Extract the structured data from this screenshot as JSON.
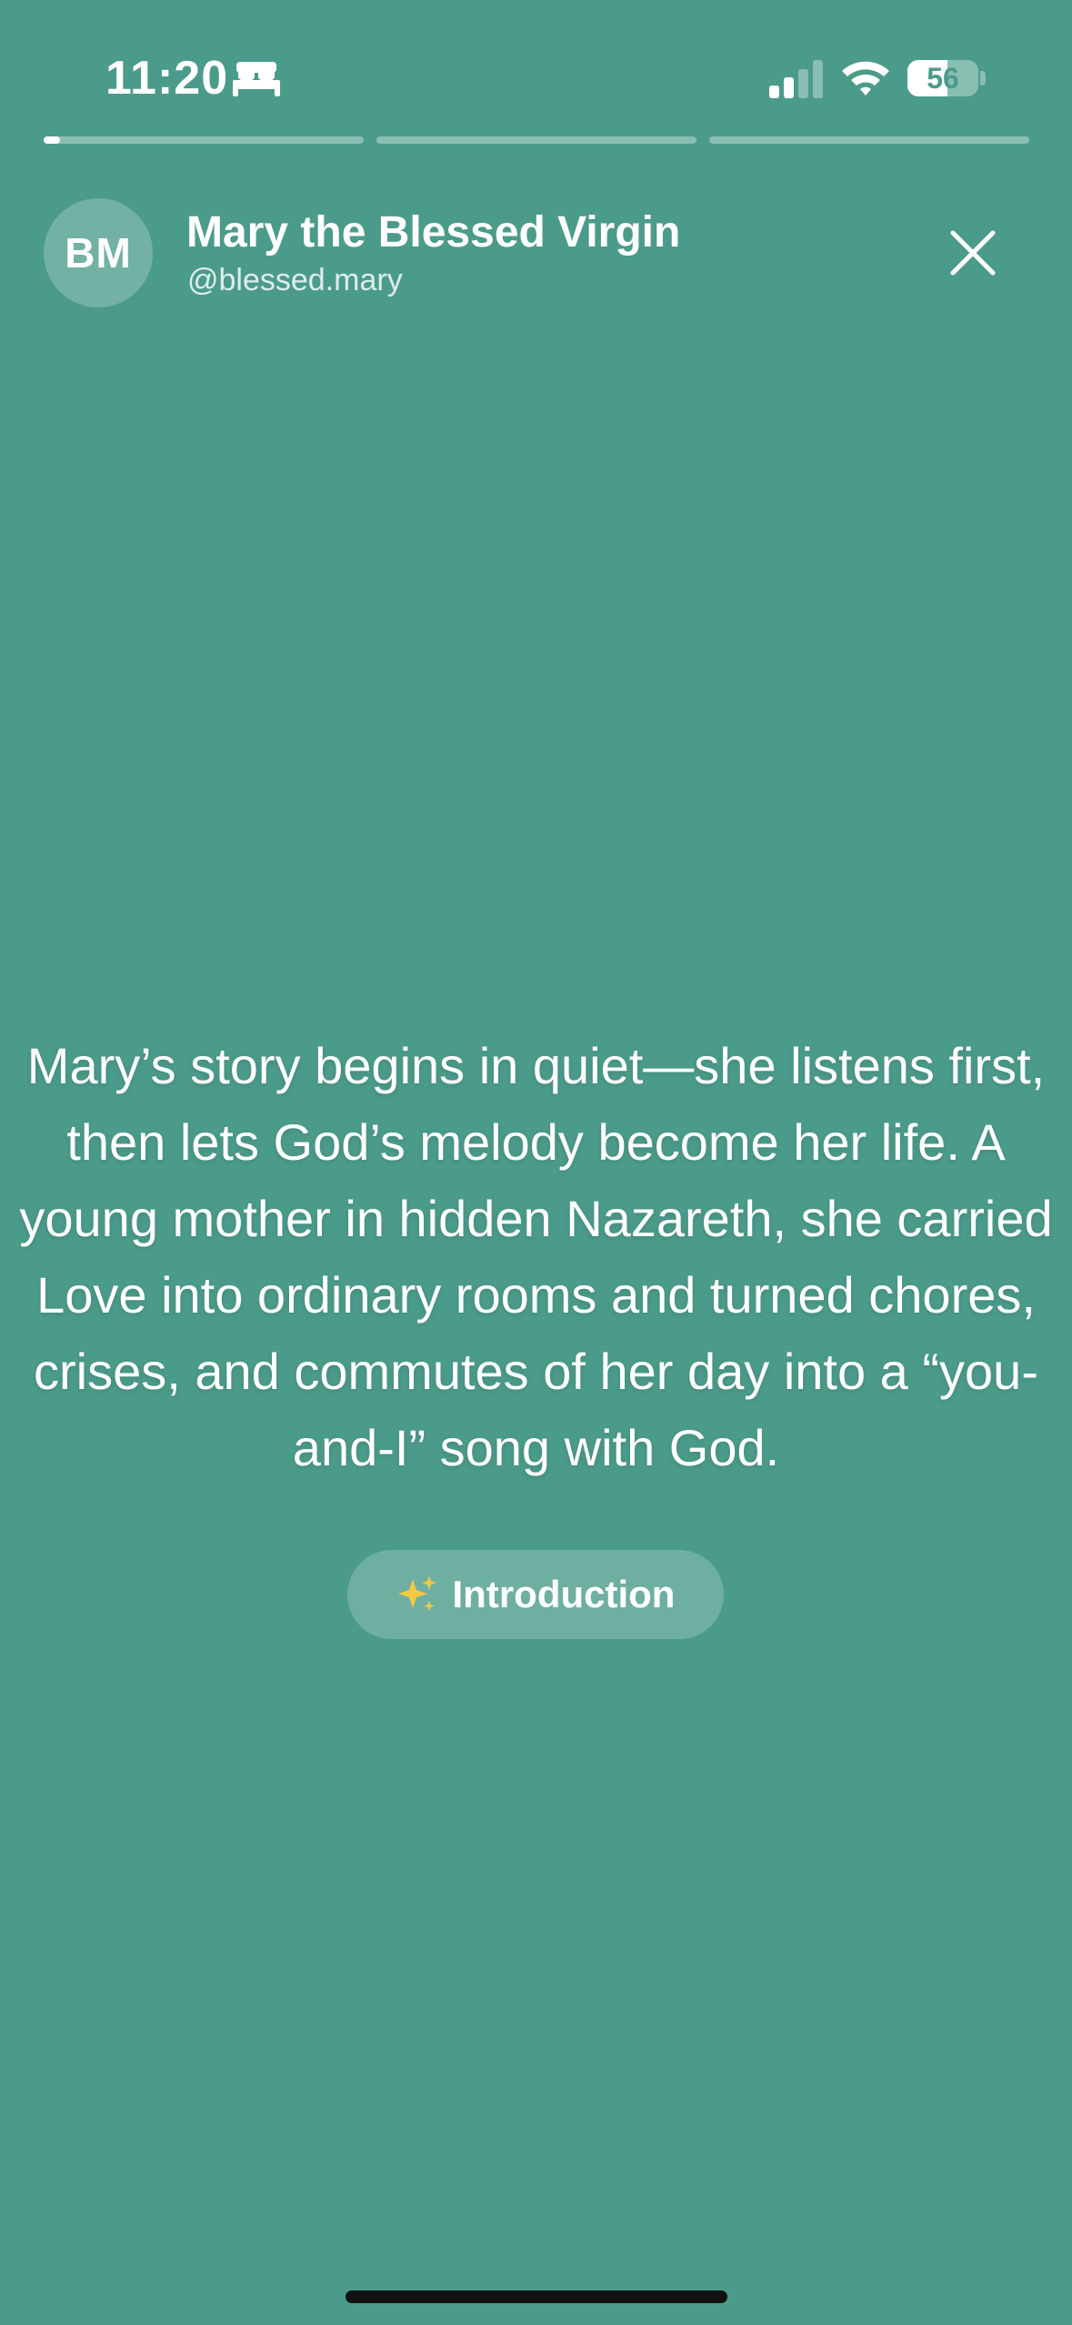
{
  "status_bar": {
    "time": "11:20",
    "focus_icon": "bed-icon",
    "signal_icon": "cellular-signal-icon",
    "signal_bars_active": 2,
    "signal_bars_total": 4,
    "wifi_icon": "wifi-icon",
    "battery_level": "56",
    "battery_fraction": 0.56
  },
  "story": {
    "segments_total": 3,
    "active_segment_progress": 0.05,
    "author": {
      "initials": "BM",
      "name": "Mary the Blessed Virgin",
      "handle": "@blessed.mary"
    },
    "close_icon": "close-icon",
    "body_text": "Mary’s story begins in quiet—she listens first, then lets God’s melody become her life. A young mother in hidden Nazareth, she carried Love into ordinary rooms and turned chores, crises, and commutes of her day into a “you-and-I” song with God.",
    "section_button": {
      "icon": "sparkles-icon",
      "label": "Introduction"
    }
  },
  "colors": {
    "background": "#4b9b8b",
    "text": "#ffffff",
    "sparkle": "#f5c842"
  }
}
